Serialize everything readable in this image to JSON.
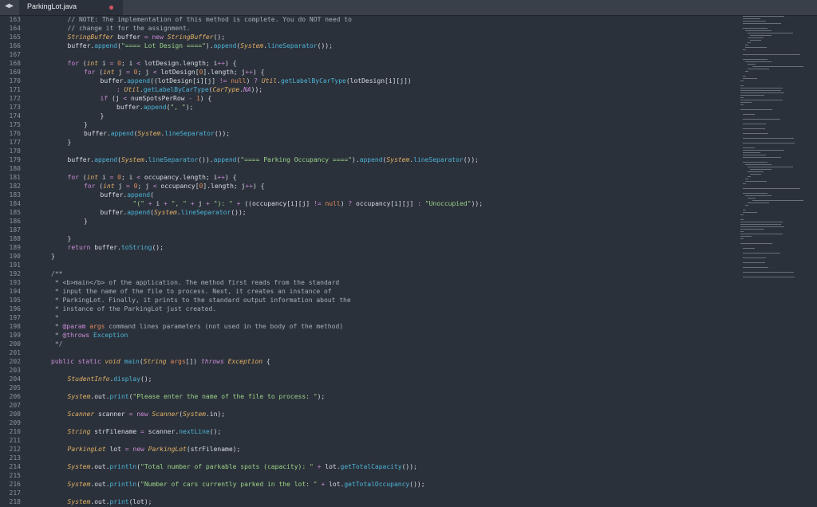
{
  "tab": {
    "filename": "ParkingLot.java",
    "nav_icon": "◀▶"
  },
  "colors": {
    "background": "#2b313a",
    "modified_dot": "#d3545f"
  },
  "lines": [
    {
      "n": "163",
      "indent": 1,
      "segs": [
        [
          "// NOTE: The implementation of this method is complete. You do NOT need to",
          "c"
        ]
      ]
    },
    {
      "n": "164",
      "indent": 1,
      "segs": [
        [
          "// change it for the assignment.",
          "c"
        ]
      ]
    },
    {
      "n": "165",
      "indent": 1,
      "segs": [
        [
          "StringBuffer",
          "t"
        ],
        [
          " buffer ",
          ""
        ],
        [
          "=",
          "k"
        ],
        [
          " ",
          ""
        ],
        [
          "new",
          "k"
        ],
        [
          " ",
          ""
        ],
        [
          "StringBuffer",
          "t"
        ],
        [
          "();",
          ""
        ]
      ]
    },
    {
      "n": "166",
      "indent": 1,
      "segs": [
        [
          "buffer.",
          ""
        ],
        [
          "append",
          "m"
        ],
        [
          "(",
          ""
        ],
        [
          "\"==== Lot Design ====\"",
          "s"
        ],
        [
          ").",
          ""
        ],
        [
          "append",
          "m"
        ],
        [
          "(",
          ""
        ],
        [
          "System",
          "t"
        ],
        [
          ".",
          ""
        ],
        [
          "lineSeparator",
          "m"
        ],
        [
          "());",
          ""
        ]
      ]
    },
    {
      "n": "167",
      "indent": 0,
      "segs": []
    },
    {
      "n": "168",
      "indent": 1,
      "segs": [
        [
          "for",
          "k"
        ],
        [
          " (",
          ""
        ],
        [
          "int",
          "t"
        ],
        [
          " i ",
          ""
        ],
        [
          "=",
          "k"
        ],
        [
          " ",
          ""
        ],
        [
          "0",
          "n"
        ],
        [
          "; i ",
          ""
        ],
        [
          "<",
          "k"
        ],
        [
          " lotDesign.length; i",
          ""
        ],
        [
          "++",
          "k"
        ],
        [
          ") {",
          ""
        ]
      ]
    },
    {
      "n": "169",
      "indent": 2,
      "segs": [
        [
          "for",
          "k"
        ],
        [
          " (",
          ""
        ],
        [
          "int",
          "t"
        ],
        [
          " j ",
          ""
        ],
        [
          "=",
          "k"
        ],
        [
          " ",
          ""
        ],
        [
          "0",
          "n"
        ],
        [
          "; j ",
          ""
        ],
        [
          "<",
          "k"
        ],
        [
          " lotDesign[",
          ""
        ],
        [
          "0",
          "n"
        ],
        [
          "].length; j",
          ""
        ],
        [
          "++",
          "k"
        ],
        [
          ") {",
          ""
        ]
      ]
    },
    {
      "n": "170",
      "indent": 3,
      "segs": [
        [
          "buffer.",
          ""
        ],
        [
          "append",
          "m"
        ],
        [
          "((lotDesign[i][j] ",
          ""
        ],
        [
          "!=",
          "k"
        ],
        [
          " ",
          ""
        ],
        [
          "null",
          "n"
        ],
        [
          ") ",
          ""
        ],
        [
          "?",
          "k"
        ],
        [
          " ",
          ""
        ],
        [
          "Util",
          "t"
        ],
        [
          ".",
          ""
        ],
        [
          "getLabelByCarType",
          "m"
        ],
        [
          "(lotDesign[i][j])",
          ""
        ]
      ]
    },
    {
      "n": "171",
      "indent": 4,
      "segs": [
        [
          ":",
          "k"
        ],
        [
          " ",
          ""
        ],
        [
          "Util",
          "t"
        ],
        [
          ".",
          ""
        ],
        [
          "getLabelByCarType",
          "m"
        ],
        [
          "(",
          ""
        ],
        [
          "CarType",
          "t"
        ],
        [
          ".",
          ""
        ],
        [
          "NA",
          "p"
        ],
        [
          "));",
          ""
        ]
      ]
    },
    {
      "n": "172",
      "indent": 3,
      "segs": [
        [
          "if",
          "k"
        ],
        [
          " (j ",
          ""
        ],
        [
          "<",
          "k"
        ],
        [
          " numSpotsPerRow ",
          ""
        ],
        [
          "-",
          "k"
        ],
        [
          " ",
          ""
        ],
        [
          "1",
          "n"
        ],
        [
          ") {",
          ""
        ]
      ]
    },
    {
      "n": "173",
      "indent": 4,
      "segs": [
        [
          "buffer.",
          ""
        ],
        [
          "append",
          "m"
        ],
        [
          "(",
          ""
        ],
        [
          "\", \"",
          "s"
        ],
        [
          ");",
          ""
        ]
      ]
    },
    {
      "n": "174",
      "indent": 3,
      "segs": [
        [
          "}",
          ""
        ]
      ]
    },
    {
      "n": "175",
      "indent": 2,
      "segs": [
        [
          "}",
          ""
        ]
      ]
    },
    {
      "n": "176",
      "indent": 2,
      "segs": [
        [
          "buffer.",
          ""
        ],
        [
          "append",
          "m"
        ],
        [
          "(",
          ""
        ],
        [
          "System",
          "t"
        ],
        [
          ".",
          ""
        ],
        [
          "lineSeparator",
          "m"
        ],
        [
          "());",
          ""
        ]
      ]
    },
    {
      "n": "177",
      "indent": 1,
      "segs": [
        [
          "}",
          ""
        ]
      ]
    },
    {
      "n": "178",
      "indent": 0,
      "segs": []
    },
    {
      "n": "179",
      "indent": 1,
      "segs": [
        [
          "buffer.",
          ""
        ],
        [
          "append",
          "m"
        ],
        [
          "(",
          ""
        ],
        [
          "System",
          "t"
        ],
        [
          ".",
          ""
        ],
        [
          "lineSeparator",
          "m"
        ],
        [
          "()).",
          ""
        ],
        [
          "append",
          "m"
        ],
        [
          "(",
          ""
        ],
        [
          "\"==== Parking Occupancy ====\"",
          "s"
        ],
        [
          ").",
          ""
        ],
        [
          "append",
          "m"
        ],
        [
          "(",
          ""
        ],
        [
          "System",
          "t"
        ],
        [
          ".",
          ""
        ],
        [
          "lineSeparator",
          "m"
        ],
        [
          "());",
          ""
        ]
      ]
    },
    {
      "n": "180",
      "indent": 0,
      "segs": []
    },
    {
      "n": "181",
      "indent": 1,
      "segs": [
        [
          "for",
          "k"
        ],
        [
          " (",
          ""
        ],
        [
          "int",
          "t"
        ],
        [
          " i ",
          ""
        ],
        [
          "=",
          "k"
        ],
        [
          " ",
          ""
        ],
        [
          "0",
          "n"
        ],
        [
          "; i ",
          ""
        ],
        [
          "<",
          "k"
        ],
        [
          " occupancy.length; i",
          ""
        ],
        [
          "++",
          "k"
        ],
        [
          ") {",
          ""
        ]
      ]
    },
    {
      "n": "182",
      "indent": 2,
      "segs": [
        [
          "for",
          "k"
        ],
        [
          " (",
          ""
        ],
        [
          "int",
          "t"
        ],
        [
          " j ",
          ""
        ],
        [
          "=",
          "k"
        ],
        [
          " ",
          ""
        ],
        [
          "0",
          "n"
        ],
        [
          "; j ",
          ""
        ],
        [
          "<",
          "k"
        ],
        [
          " occupancy[",
          ""
        ],
        [
          "0",
          "n"
        ],
        [
          "].length; j",
          ""
        ],
        [
          "++",
          "k"
        ],
        [
          ") {",
          ""
        ]
      ]
    },
    {
      "n": "183",
      "indent": 3,
      "segs": [
        [
          "buffer.",
          ""
        ],
        [
          "append",
          "m"
        ],
        [
          "(",
          ""
        ]
      ]
    },
    {
      "n": "184",
      "indent": 5,
      "segs": [
        [
          "\"(\"",
          "s"
        ],
        [
          " ",
          ""
        ],
        [
          "+",
          "k"
        ],
        [
          " i ",
          ""
        ],
        [
          "+",
          "k"
        ],
        [
          " ",
          ""
        ],
        [
          "\", \"",
          "s"
        ],
        [
          " ",
          ""
        ],
        [
          "+",
          "k"
        ],
        [
          " j ",
          ""
        ],
        [
          "+",
          "k"
        ],
        [
          " ",
          ""
        ],
        [
          "\"): \"",
          "s"
        ],
        [
          " ",
          ""
        ],
        [
          "+",
          "k"
        ],
        [
          " ((occupancy[i][j] ",
          ""
        ],
        [
          "!=",
          "k"
        ],
        [
          " ",
          ""
        ],
        [
          "null",
          "n"
        ],
        [
          ") ",
          ""
        ],
        [
          "?",
          "k"
        ],
        [
          " occupancy[i][j] ",
          ""
        ],
        [
          ":",
          "k"
        ],
        [
          " ",
          ""
        ],
        [
          "\"Unoccupied\"",
          "s"
        ],
        [
          "));",
          ""
        ]
      ]
    },
    {
      "n": "185",
      "indent": 3,
      "segs": [
        [
          "buffer.",
          ""
        ],
        [
          "append",
          "m"
        ],
        [
          "(",
          ""
        ],
        [
          "System",
          "t"
        ],
        [
          ".",
          ""
        ],
        [
          "lineSeparator",
          "m"
        ],
        [
          "());",
          ""
        ]
      ]
    },
    {
      "n": "186",
      "indent": 2,
      "segs": [
        [
          "}",
          ""
        ]
      ]
    },
    {
      "n": "187",
      "indent": 0,
      "segs": []
    },
    {
      "n": "188",
      "indent": 1,
      "segs": [
        [
          "}",
          ""
        ]
      ]
    },
    {
      "n": "189",
      "indent": 1,
      "segs": [
        [
          "return",
          "k"
        ],
        [
          " buffer.",
          ""
        ],
        [
          "toString",
          "m"
        ],
        [
          "();",
          ""
        ]
      ]
    },
    {
      "n": "190",
      "indent": 0,
      "segs": [
        [
          "}",
          ""
        ]
      ]
    },
    {
      "n": "191",
      "indent": 0,
      "segs": []
    },
    {
      "n": "192",
      "indent": 0,
      "segs": [
        [
          "/**",
          "c"
        ]
      ]
    },
    {
      "n": "193",
      "indent": 0,
      "segs": [
        [
          " * <b>main</b> of the application. The method first reads from the standard",
          "c"
        ]
      ]
    },
    {
      "n": "194",
      "indent": 0,
      "segs": [
        [
          " * input the name of the file to process. Next, it creates an instance of",
          "c"
        ]
      ]
    },
    {
      "n": "195",
      "indent": 0,
      "segs": [
        [
          " * ParkingLot. Finally, it prints to the standard output information about the",
          "c"
        ]
      ]
    },
    {
      "n": "196",
      "indent": 0,
      "segs": [
        [
          " * instance of the ParkingLot just created.",
          "c"
        ]
      ]
    },
    {
      "n": "197",
      "indent": 0,
      "segs": [
        [
          " *",
          "c"
        ]
      ]
    },
    {
      "n": "198",
      "indent": 0,
      "segs": [
        [
          " * ",
          "c"
        ],
        [
          "@param",
          "k"
        ],
        [
          " ",
          ""
        ],
        [
          "args",
          "n"
        ],
        [
          " command lines parameters (not used in the body of the method)",
          "c"
        ]
      ]
    },
    {
      "n": "199",
      "indent": 0,
      "segs": [
        [
          " * ",
          "c"
        ],
        [
          "@throws",
          "k"
        ],
        [
          " ",
          ""
        ],
        [
          "Exception",
          "m"
        ]
      ]
    },
    {
      "n": "200",
      "indent": 0,
      "segs": [
        [
          " */",
          "c"
        ]
      ]
    },
    {
      "n": "201",
      "indent": 0,
      "segs": []
    },
    {
      "n": "202",
      "indent": 0,
      "segs": [
        [
          "public",
          "k"
        ],
        [
          " ",
          ""
        ],
        [
          "static",
          "k"
        ],
        [
          " ",
          ""
        ],
        [
          "void",
          "t"
        ],
        [
          " ",
          ""
        ],
        [
          "main",
          "m"
        ],
        [
          "(",
          ""
        ],
        [
          "String",
          "t"
        ],
        [
          " ",
          ""
        ],
        [
          "args",
          "n"
        ],
        [
          "[]",
          ""
        ],
        [
          ") ",
          ""
        ],
        [
          "throws",
          "p"
        ],
        [
          " ",
          ""
        ],
        [
          "Exception",
          "t"
        ],
        [
          " {",
          ""
        ]
      ]
    },
    {
      "n": "203",
      "indent": 0,
      "segs": []
    },
    {
      "n": "204",
      "indent": 1,
      "segs": [
        [
          "StudentInfo",
          "t"
        ],
        [
          ".",
          ""
        ],
        [
          "display",
          "m"
        ],
        [
          "();",
          ""
        ]
      ]
    },
    {
      "n": "205",
      "indent": 0,
      "segs": []
    },
    {
      "n": "206",
      "indent": 1,
      "segs": [
        [
          "System",
          "t"
        ],
        [
          ".out.",
          ""
        ],
        [
          "print",
          "m"
        ],
        [
          "(",
          ""
        ],
        [
          "\"Please enter the name of the file to process: \"",
          "s"
        ],
        [
          ");",
          ""
        ]
      ]
    },
    {
      "n": "207",
      "indent": 0,
      "segs": []
    },
    {
      "n": "208",
      "indent": 1,
      "segs": [
        [
          "Scanner",
          "t"
        ],
        [
          " scanner ",
          ""
        ],
        [
          "=",
          "k"
        ],
        [
          " ",
          ""
        ],
        [
          "new",
          "k"
        ],
        [
          " ",
          ""
        ],
        [
          "Scanner",
          "t"
        ],
        [
          "(",
          ""
        ],
        [
          "System",
          "t"
        ],
        [
          ".in);",
          ""
        ]
      ]
    },
    {
      "n": "209",
      "indent": 0,
      "segs": []
    },
    {
      "n": "210",
      "indent": 1,
      "segs": [
        [
          "String",
          "t"
        ],
        [
          " strFilename ",
          ""
        ],
        [
          "=",
          "k"
        ],
        [
          " scanner.",
          ""
        ],
        [
          "nextLine",
          "m"
        ],
        [
          "();",
          ""
        ]
      ]
    },
    {
      "n": "211",
      "indent": 0,
      "segs": []
    },
    {
      "n": "212",
      "indent": 1,
      "segs": [
        [
          "ParkingLot",
          "t"
        ],
        [
          " lot ",
          ""
        ],
        [
          "=",
          "k"
        ],
        [
          " ",
          ""
        ],
        [
          "new",
          "k"
        ],
        [
          " ",
          ""
        ],
        [
          "ParkingLot",
          "t"
        ],
        [
          "(strFilename);",
          ""
        ]
      ]
    },
    {
      "n": "213",
      "indent": 0,
      "segs": []
    },
    {
      "n": "214",
      "indent": 1,
      "segs": [
        [
          "System",
          "t"
        ],
        [
          ".out.",
          ""
        ],
        [
          "println",
          "m"
        ],
        [
          "(",
          ""
        ],
        [
          "\"Total number of parkable spots (capacity): \"",
          "s"
        ],
        [
          " ",
          ""
        ],
        [
          "+",
          "k"
        ],
        [
          " lot.",
          ""
        ],
        [
          "getTotalCapacity",
          "m"
        ],
        [
          "());",
          ""
        ]
      ]
    },
    {
      "n": "215",
      "indent": 0,
      "segs": []
    },
    {
      "n": "216",
      "indent": 1,
      "segs": [
        [
          "System",
          "t"
        ],
        [
          ".out.",
          ""
        ],
        [
          "println",
          "m"
        ],
        [
          "(",
          ""
        ],
        [
          "\"Number of cars currently parked in the lot: \"",
          "s"
        ],
        [
          " ",
          ""
        ],
        [
          "+",
          "k"
        ],
        [
          " lot.",
          ""
        ],
        [
          "getTotalOccupancy",
          "m"
        ],
        [
          "());",
          ""
        ]
      ]
    },
    {
      "n": "217",
      "indent": 0,
      "segs": []
    },
    {
      "n": "218",
      "indent": 1,
      "segs": [
        [
          "System",
          "t"
        ],
        [
          ".out.",
          ""
        ],
        [
          "print",
          "m"
        ],
        [
          "(lot);",
          ""
        ]
      ]
    }
  ]
}
